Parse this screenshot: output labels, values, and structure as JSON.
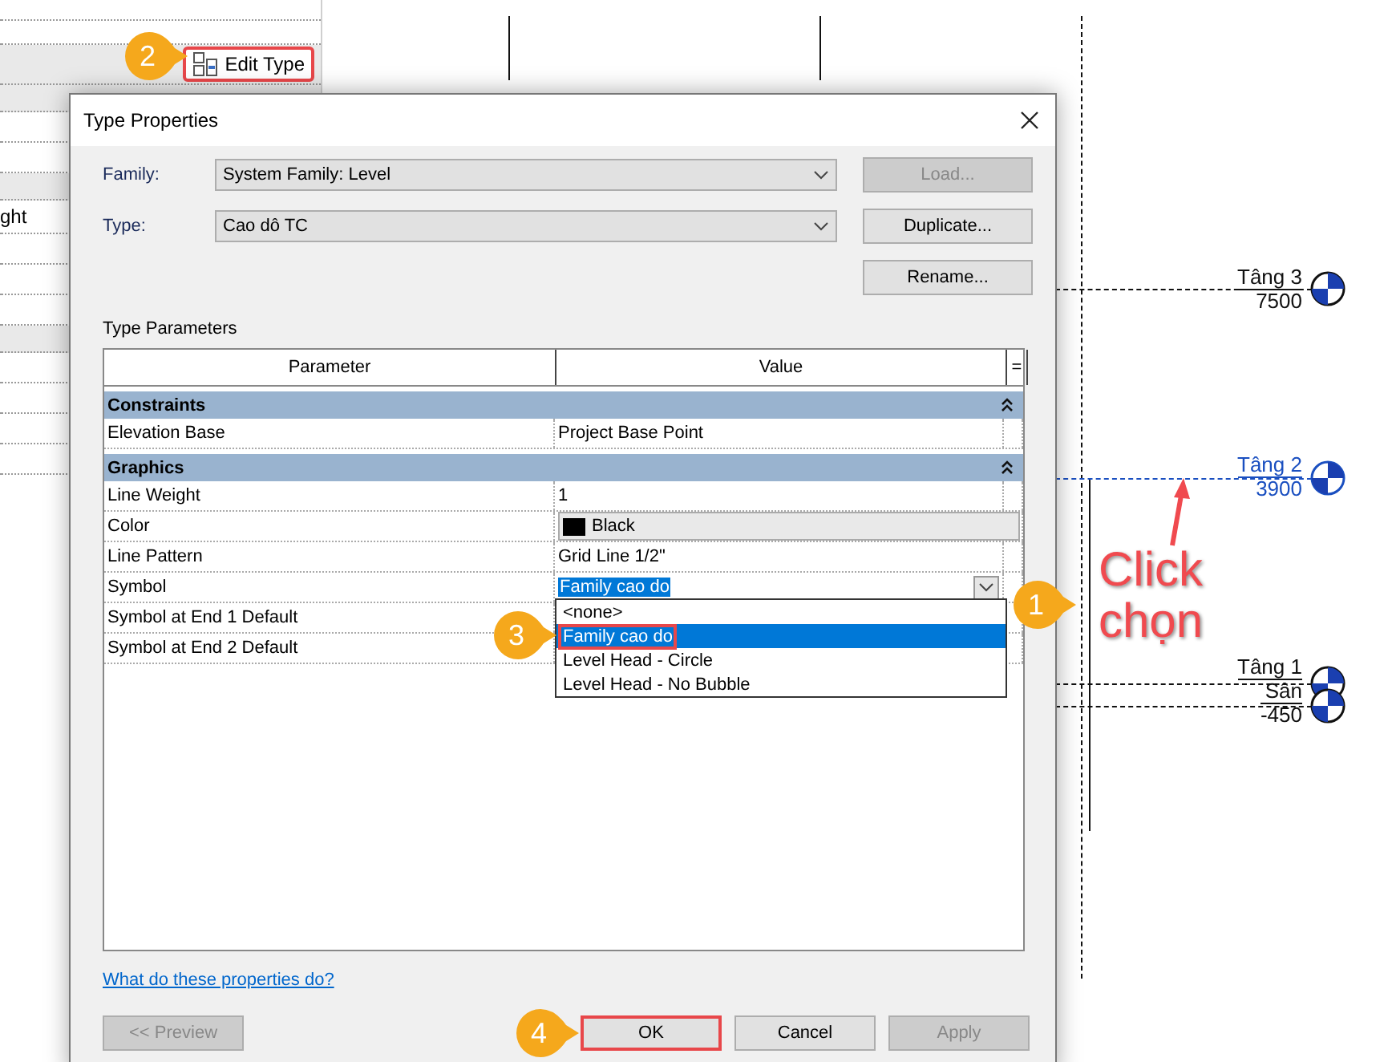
{
  "properties_panel": {
    "row_label": "ght",
    "edit_type_button": {
      "label": "Edit Type",
      "highlighted": true
    }
  },
  "drawing": {
    "levels": [
      {
        "name": "Tâng 3",
        "elevation": "7500",
        "selected": false
      },
      {
        "name": "Tâng 2",
        "elevation": "3900",
        "selected": true
      },
      {
        "name": "Tâng 1",
        "selected": false
      },
      {
        "name": "Sân",
        "elevation": "-450",
        "selected": false
      }
    ],
    "annotation": "Click chọn"
  },
  "dialog": {
    "title": "Type Properties",
    "fields": [
      {
        "label": "Family:",
        "value": "System Family: Level"
      },
      {
        "label": "Type:",
        "value": "Cao dô TC"
      }
    ],
    "side_buttons": [
      {
        "label": "Load...",
        "disabled": true
      },
      {
        "label": "Duplicate...",
        "disabled": false
      },
      {
        "label": "Rename...",
        "disabled": false
      }
    ],
    "section_title": "Type Parameters",
    "table": {
      "columns": [
        "Parameter",
        "Value"
      ],
      "corner": "=",
      "rows": [
        {
          "kind": "group",
          "label": "Constraints",
          "expanded": true
        },
        {
          "kind": "text",
          "name": "Elevation Base",
          "value": "Project Base Point"
        },
        {
          "kind": "group",
          "label": "Graphics",
          "expanded": true
        },
        {
          "kind": "text",
          "name": "Line Weight",
          "value": "1"
        },
        {
          "kind": "color",
          "name": "Color",
          "value": "Black"
        },
        {
          "kind": "text",
          "name": "Line Pattern",
          "value": "Grid Line 1/2\""
        },
        {
          "kind": "dropdown",
          "name": "Symbol",
          "value": "Family cao do",
          "open": true,
          "options": [
            {
              "label": "<none>",
              "selected": false,
              "highlighted": false
            },
            {
              "label": "Family cao do",
              "selected": true,
              "highlighted": true
            },
            {
              "label": "Level Head - Circle",
              "selected": false,
              "highlighted": false
            },
            {
              "label": "Level Head - No Bubble",
              "selected": false,
              "highlighted": false
            }
          ]
        },
        {
          "kind": "text",
          "name": "Symbol at End 1 Default",
          "value": ""
        },
        {
          "kind": "text",
          "name": "Symbol at End 2 Default",
          "value": ""
        }
      ]
    },
    "help_link": "What do these properties do?",
    "footer_buttons": [
      {
        "label": "<< Preview",
        "disabled": true,
        "highlighted": false
      },
      {
        "label": "OK",
        "disabled": false,
        "highlighted": true
      },
      {
        "label": "Cancel",
        "disabled": false,
        "highlighted": false
      },
      {
        "label": "Apply",
        "disabled": true,
        "highlighted": false
      }
    ]
  },
  "step_badges": [
    {
      "number": "2"
    },
    {
      "number": "1"
    },
    {
      "number": "3"
    },
    {
      "number": "4"
    }
  ]
}
